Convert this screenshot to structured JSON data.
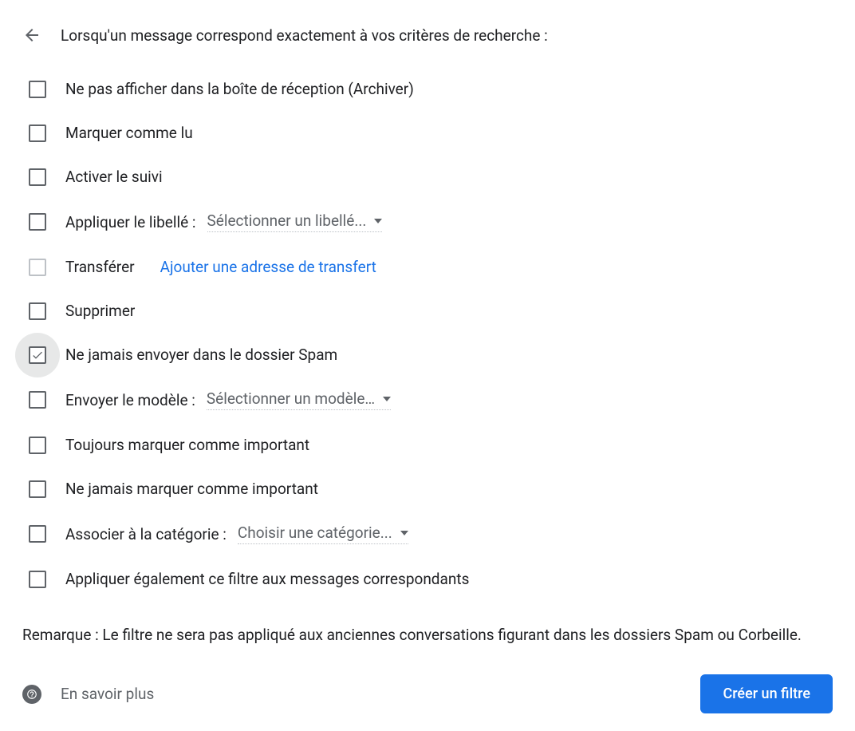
{
  "title": "Lorsqu'un message correspond exactement à vos critères de recherche :",
  "options": {
    "archive": {
      "label": "Ne pas afficher dans la boîte de réception (Archiver)",
      "checked": false
    },
    "mark_read": {
      "label": "Marquer comme lu",
      "checked": false
    },
    "star": {
      "label": "Activer le suivi",
      "checked": false
    },
    "apply_label": {
      "label": "Appliquer le libellé :",
      "dropdown": "Sélectionner un libellé...",
      "checked": false
    },
    "forward": {
      "label": "Transférer",
      "link": "Ajouter une adresse de transfert",
      "checked": false,
      "disabled": true
    },
    "delete": {
      "label": "Supprimer",
      "checked": false
    },
    "never_spam": {
      "label": "Ne jamais envoyer dans le dossier Spam",
      "checked": true,
      "focused": true
    },
    "send_template": {
      "label": "Envoyer le modèle :",
      "dropdown": "Sélectionner un modèle…",
      "checked": false
    },
    "always_important": {
      "label": "Toujours marquer comme important",
      "checked": false
    },
    "never_important": {
      "label": "Ne jamais marquer comme important",
      "checked": false
    },
    "categorize": {
      "label": "Associer à la catégorie :",
      "dropdown": "Choisir une catégorie...",
      "checked": false
    },
    "apply_matching": {
      "label": "Appliquer également ce filtre aux messages correspondants",
      "checked": false
    }
  },
  "note": "Remarque : Le filtre ne sera pas appliqué aux anciennes conversations figurant dans les dossiers Spam ou Corbeille.",
  "footer": {
    "learn_more": "En savoir plus",
    "create_button": "Créer un filtre"
  }
}
